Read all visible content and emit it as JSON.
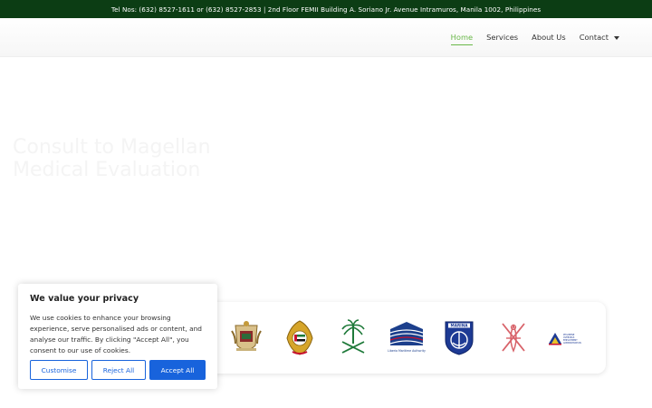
{
  "topbar": {
    "contact_line": "Tel Nos: (632) 8527-1611 or (632) 8527-2853 | 2nd Floor FEMII Building A. Soriano Jr. Avenue Intramuros, Manila 1002, Philippines"
  },
  "nav": {
    "items": [
      {
        "label": "Home",
        "active": true
      },
      {
        "label": "Services"
      },
      {
        "label": "About Us"
      },
      {
        "label": "Contact",
        "has_dropdown": true
      }
    ]
  },
  "hero": {
    "title": "Consult to Magellan\nMedical Evaluation"
  },
  "logos": [
    {
      "name": "crest-logo"
    },
    {
      "name": "uae-emblem-logo"
    },
    {
      "name": "saudi-palm-logo"
    },
    {
      "name": "liberia-maritime-authority-logo",
      "caption": "Liberia Maritime Authority"
    },
    {
      "name": "marina-logo",
      "caption": "MARINA"
    },
    {
      "name": "oman-emblem-logo"
    },
    {
      "name": "poea-logo",
      "caption": "PHILIPPINE OVERSEAS EMPLOYMENT ADMINISTRATION"
    }
  ],
  "cookie": {
    "title": "We value your privacy",
    "text": "We use cookies to enhance your browsing experience, serve personalised ads or content, and analyse our traffic. By clicking \"Accept All\", you consent to our use of cookies.",
    "customise_label": "Customise",
    "reject_label": "Reject All",
    "accept_label": "Accept All"
  },
  "colors": {
    "topbar_bg": "#0c3d14",
    "nav_active": "#6ab84a",
    "cookie_button": "#1863dc"
  }
}
